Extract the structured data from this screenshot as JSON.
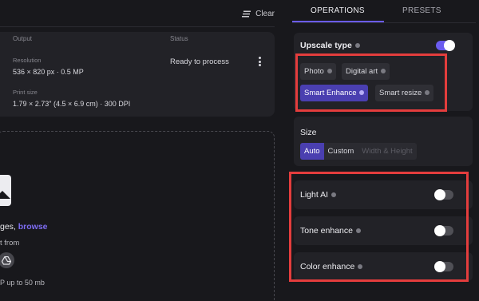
{
  "toolbar": {
    "clear_label": "Clear"
  },
  "file_list": {
    "columns": [
      "Output",
      "Status"
    ],
    "item": {
      "resolution_label": "Resolution",
      "resolution_value": "536 × 820 px · 0.5 MP",
      "print_size_label": "Print size",
      "print_size_value": "1.79 × 2.73\" (4.5 × 6.9 cm) · 300 DPI",
      "status": "Ready to process"
    }
  },
  "dropzone": {
    "text_prefix": "ges, ",
    "browse_label": "browse",
    "import_text": "t from",
    "limit_text": "P up to 50 mb"
  },
  "tabs": [
    {
      "label": "OPERATIONS",
      "active": true
    },
    {
      "label": "PRESETS",
      "active": false
    }
  ],
  "upscale": {
    "title": "Upscale type",
    "enabled": true,
    "options": [
      {
        "label": "Photo",
        "selected": false
      },
      {
        "label": "Digital art",
        "selected": false
      },
      {
        "label": "Smart Enhance",
        "selected": true
      },
      {
        "label": "Smart resize",
        "selected": false
      }
    ]
  },
  "size": {
    "title": "Size",
    "options": [
      {
        "label": "Auto",
        "state": "selected"
      },
      {
        "label": "Custom",
        "state": "normal"
      },
      {
        "label": "Width & Height",
        "state": "disabled"
      }
    ]
  },
  "toggles": [
    {
      "label": "Light AI",
      "on": false
    },
    {
      "label": "Tone enhance",
      "on": false
    },
    {
      "label": "Color enhance",
      "on": false
    }
  ],
  "colors": {
    "accent": "#6b5cf0",
    "selected_chip": "#4a3fb0",
    "highlight": "#e43d3d"
  }
}
